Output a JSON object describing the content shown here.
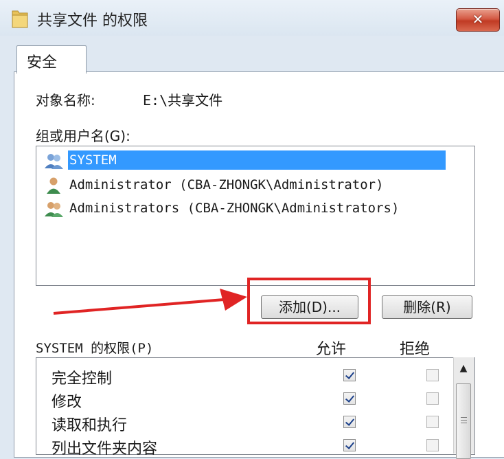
{
  "window": {
    "title": "共享文件 的权限",
    "close_glyph": "✕"
  },
  "tabs": [
    {
      "label": "安全"
    }
  ],
  "object": {
    "label": "对象名称:",
    "value": "E:\\共享文件"
  },
  "groups": {
    "label": "组或用户名(G):",
    "items": [
      {
        "name": "SYSTEM",
        "icon": "users-group-icon",
        "selected": true
      },
      {
        "name": "Administrator (CBA-ZHONGK\\Administrator)",
        "icon": "user-icon",
        "selected": false
      },
      {
        "name": "Administrators (CBA-ZHONGK\\Administrators)",
        "icon": "users-group-icon",
        "selected": false
      }
    ]
  },
  "buttons": {
    "add": "添加(D)...",
    "remove": "删除(R)"
  },
  "permissions": {
    "label": "SYSTEM 的权限(P)",
    "allow_header": "允许",
    "deny_header": "拒绝",
    "items": [
      {
        "name": "完全控制",
        "allow": true,
        "deny": false
      },
      {
        "name": "修改",
        "allow": true,
        "deny": false
      },
      {
        "name": "读取和执行",
        "allow": true,
        "deny": false
      },
      {
        "name": "列出文件夹内容",
        "allow": true,
        "deny": false
      }
    ]
  },
  "colors": {
    "selection": "#3399ff",
    "highlight": "#e02424"
  }
}
